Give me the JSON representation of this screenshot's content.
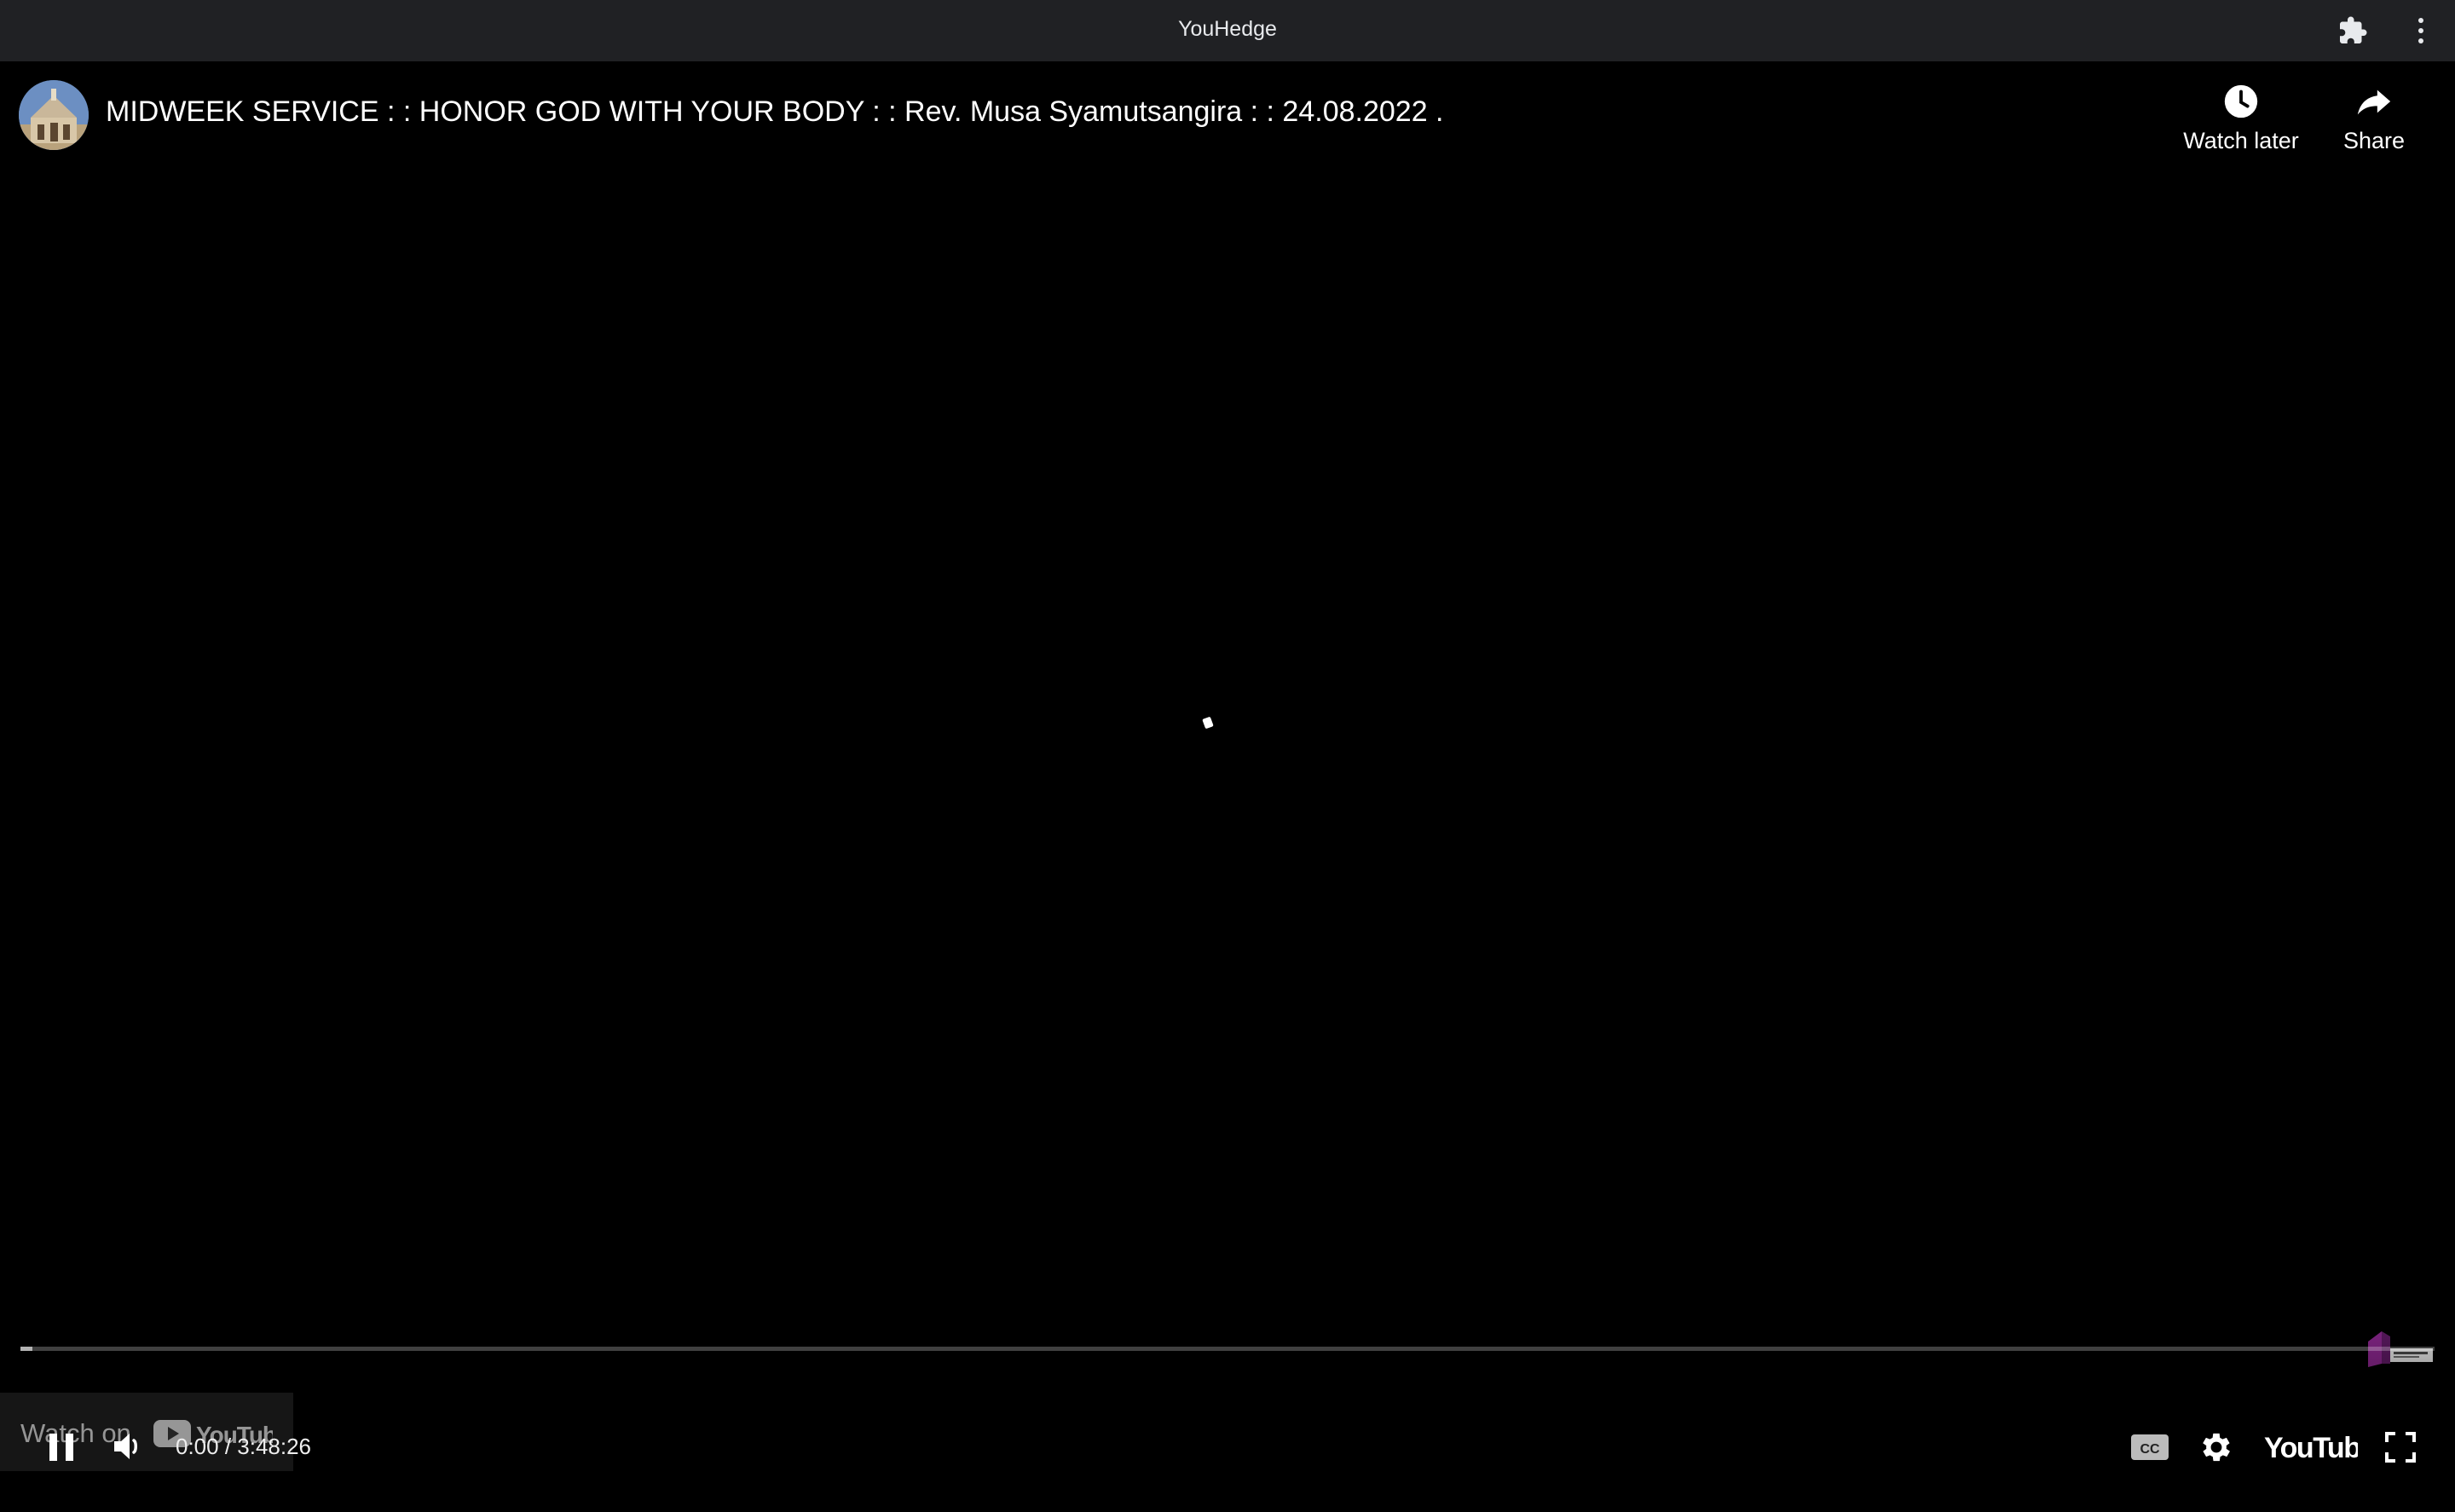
{
  "window": {
    "title": "YouHedge"
  },
  "toolbar": {
    "extension_icon": "puzzle-icon",
    "menu_icon": "more-vert-icon"
  },
  "video": {
    "title": "MIDWEEK SERVICE : : HONOR GOD WITH YOUR BODY : : Rev. Musa Syamutsangira : : 24.08.2022 .",
    "channel_avatar_icon": "church-avatar",
    "watch_later_label": "Watch later",
    "share_label": "Share",
    "watch_on_label": "Watch on",
    "watch_on_brand": "YouTube",
    "brand_label": "YouTube"
  },
  "controls": {
    "time_display": "0:00 / 3:48:26",
    "progress_fraction": 0.0,
    "state": "playing",
    "volume_state": "low"
  },
  "colors": {
    "titlebar_bg": "#202124",
    "progress_red": "#ff0000",
    "watermark_purple": "#9b2c9f"
  }
}
